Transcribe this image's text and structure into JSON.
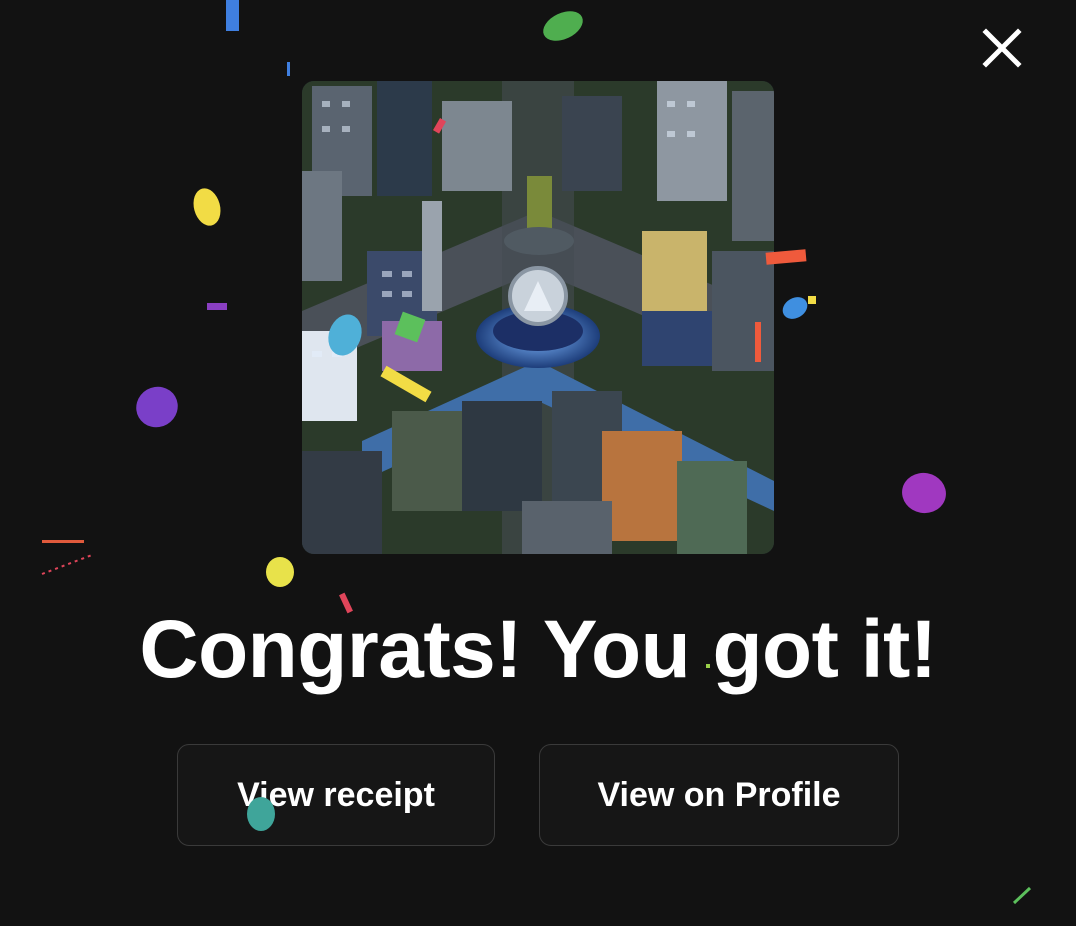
{
  "modal": {
    "title": "Congrats! You got it!",
    "close_icon": "close-icon",
    "artwork_alt": "Isometric city artwork"
  },
  "actions": {
    "view_receipt_label": "View receipt",
    "view_profile_label": "View on Profile"
  },
  "colors": {
    "background": "#121212",
    "text": "#ffffff",
    "button_border": "#3a3a3a"
  }
}
